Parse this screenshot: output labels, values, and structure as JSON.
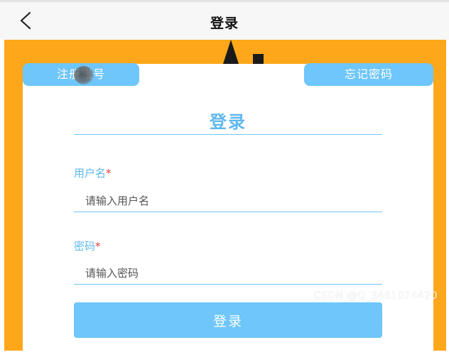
{
  "header": {
    "back_icon": "chevron-left-icon",
    "title": "登录"
  },
  "top_links": {
    "register": "注册账号",
    "forgot_password": "忘记密码"
  },
  "form": {
    "heading": "登录",
    "username": {
      "label": "用户名",
      "required_mark": "*",
      "placeholder": "请输入用户名",
      "value": ""
    },
    "password": {
      "label": "密码",
      "required_mark": "*",
      "placeholder": "请输入密码",
      "value": ""
    },
    "submit_label": "登录"
  },
  "watermark": "CSDN @Q_3461074420",
  "colors": {
    "accent": "#6ec6fa",
    "background_panel": "#ffa71a",
    "required": "#e53935"
  }
}
